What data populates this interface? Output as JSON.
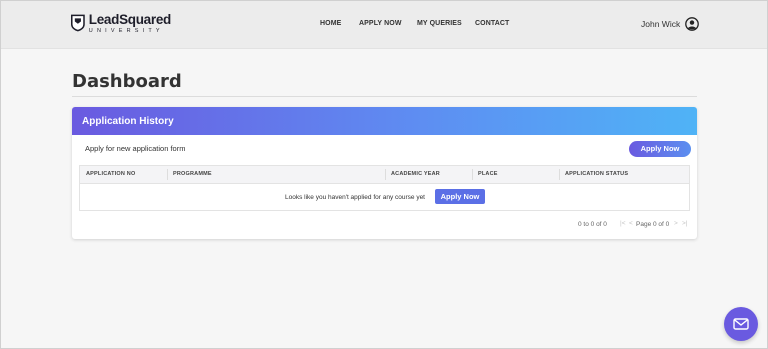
{
  "brand": {
    "name": "LeadSquared",
    "subtitle": "UNIVERSITY"
  },
  "nav": {
    "items": [
      {
        "label": "HOME"
      },
      {
        "label": "APPLY NOW"
      },
      {
        "label": "MY QUERIES"
      },
      {
        "label": "CONTACT"
      }
    ]
  },
  "user": {
    "name": "John Wick",
    "icon": "user-circle-icon"
  },
  "page": {
    "title": "Dashboard"
  },
  "card": {
    "title": "Application History",
    "apply_prompt": "Apply for new application form",
    "apply_button": "Apply Now",
    "table": {
      "columns": [
        "APPLICATION NO",
        "PROGRAMME",
        "ACADEMIC YEAR",
        "PLACE",
        "APPLICATION STATUS"
      ],
      "empty_message": "Looks like you haven't applied for any course yet",
      "empty_button": "Apply Now"
    },
    "pagination": {
      "count": "0 to 0 of 0",
      "page": "Page 0 of 0",
      "first": "|<",
      "prev": "<",
      "next": ">",
      "last": ">|"
    }
  },
  "fab": {
    "icon": "mail-icon"
  },
  "colors": {
    "accent": "#6a5ae0",
    "gradient_end": "#4fb3f6"
  }
}
